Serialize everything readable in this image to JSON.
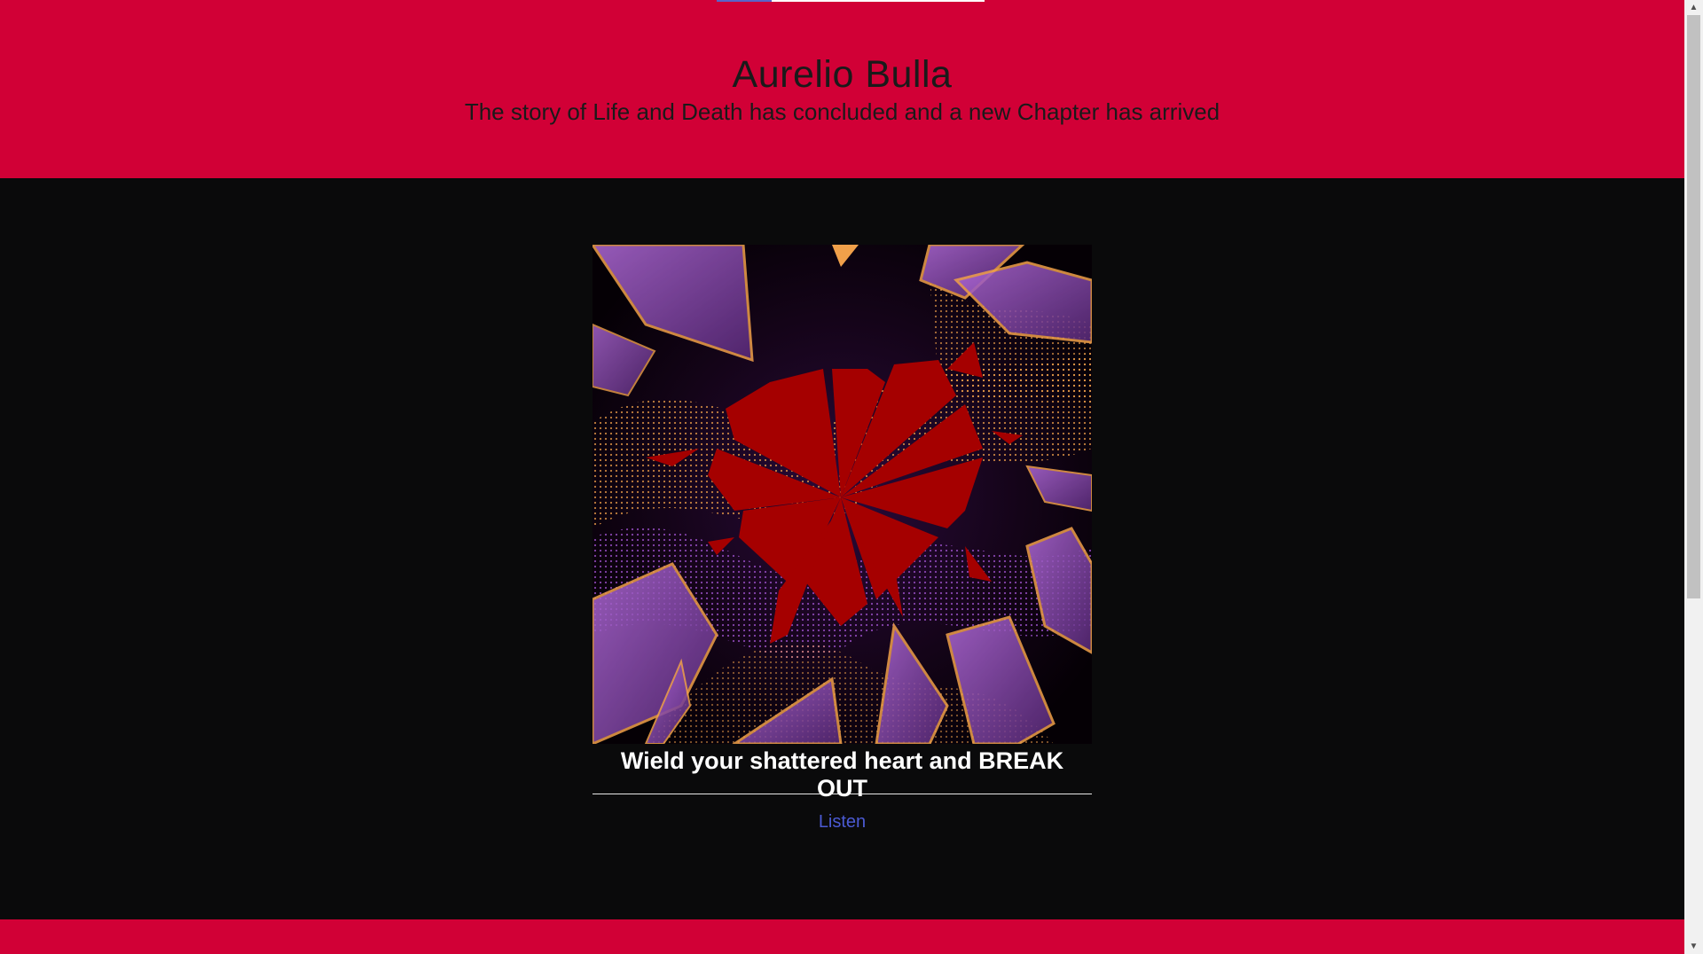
{
  "header": {
    "title": "Aurelio Bulla",
    "subtitle": "The story of Life and Death has concluded and a new Chapter has arrived"
  },
  "release": {
    "caption": "Wield your shattered heart and BREAK OUT",
    "listen_label": "Listen",
    "art_icon": "shattered-heart-artwork"
  },
  "scrollbar": {
    "up_glyph": "▲",
    "down_glyph": "▼"
  },
  "colors": {
    "brand_red": "#d10036",
    "background": "#0a0a0b",
    "link": "#4b5ad3"
  }
}
